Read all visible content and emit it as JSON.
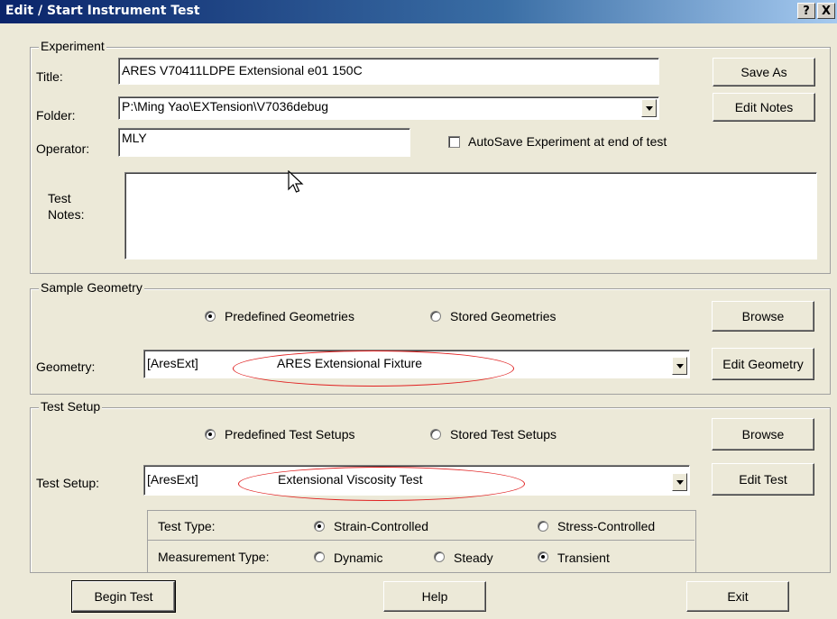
{
  "window": {
    "title": "Edit / Start Instrument Test",
    "help_glyph": "?",
    "close_glyph": "X"
  },
  "experiment": {
    "legend": "Experiment",
    "title_label": "Title:",
    "title_value": "ARES V70411LDPE  Extensional e01 150C",
    "folder_label": "Folder:",
    "folder_value": "P:\\Ming Yao\\EXTension\\V7036debug",
    "operator_label": "Operator:",
    "operator_value": "MLY",
    "autosave_label": "AutoSave Experiment at end of test",
    "autosave_checked": false,
    "notes_label_1": "Test",
    "notes_label_2": "Notes:",
    "notes_value": "",
    "save_as": "Save As",
    "edit_notes": "Edit Notes"
  },
  "geometry": {
    "legend": "Sample Geometry",
    "radio_predefined": "Predefined Geometries",
    "radio_stored": "Stored Geometries",
    "selected": "predefined",
    "label": "Geometry:",
    "prefix": "[AresExt]",
    "value": "ARES Extensional Fixture",
    "browse": "Browse",
    "edit": "Edit Geometry"
  },
  "test_setup": {
    "legend": "Test Setup",
    "radio_predefined": "Predefined Test Setups",
    "radio_stored": "Stored Test Setups",
    "selected": "predefined",
    "label": "Test Setup:",
    "prefix": "[AresExt]",
    "value": "Extensional Viscosity Test",
    "browse": "Browse",
    "edit": "Edit Test",
    "test_type_label": "Test Type:",
    "test_type_options": [
      "Strain-Controlled",
      "Stress-Controlled"
    ],
    "test_type_selected": "Strain-Controlled",
    "measurement_label": "Measurement Type:",
    "measurement_options": [
      "Dynamic",
      "Steady",
      "Transient"
    ],
    "measurement_selected": "Transient"
  },
  "footer": {
    "begin": "Begin Test",
    "help": "Help",
    "exit": "Exit"
  },
  "colors": {
    "title_start": "#0a246a",
    "title_end": "#a6caf0",
    "face": "#ece9d8",
    "highlight_ellipse": "#e02020"
  }
}
